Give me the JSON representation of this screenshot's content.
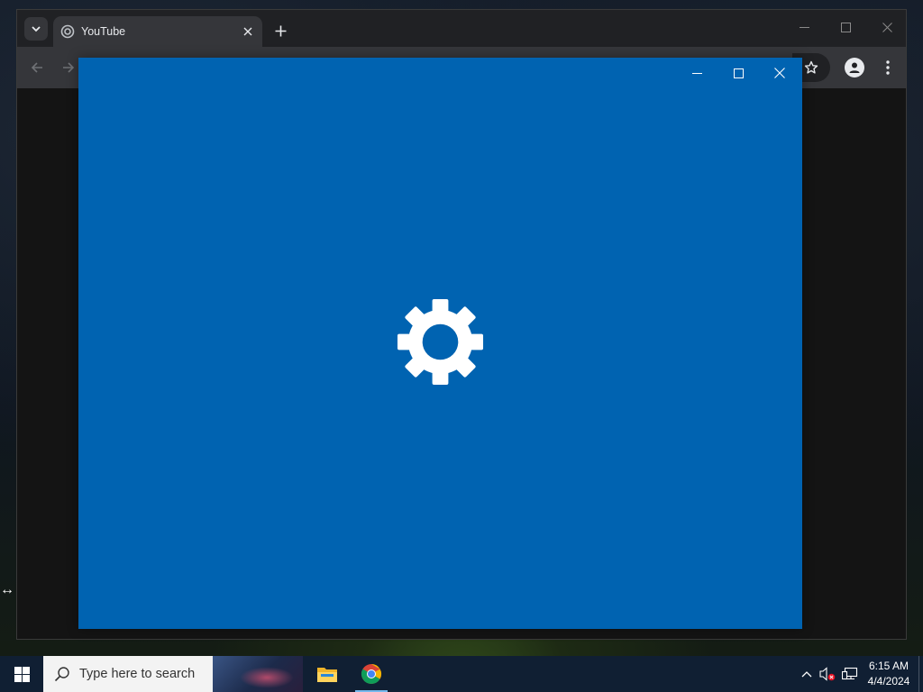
{
  "browser": {
    "tab": {
      "title": "YouTube"
    }
  },
  "taskbar": {
    "search_placeholder": "Type here to search",
    "apps": [
      "file-explorer",
      "google-chrome"
    ],
    "clock": {
      "time": "6:15 AM",
      "date": "4/4/2024"
    }
  },
  "icons": {
    "splash": "gear-icon",
    "start": "windows-logo-icon"
  },
  "colors": {
    "settings_splash_bg": "#0063b1",
    "taskbar_bg": "#101f33",
    "chrome_tabstrip": "#202124",
    "chrome_toolbar": "#35363a"
  }
}
